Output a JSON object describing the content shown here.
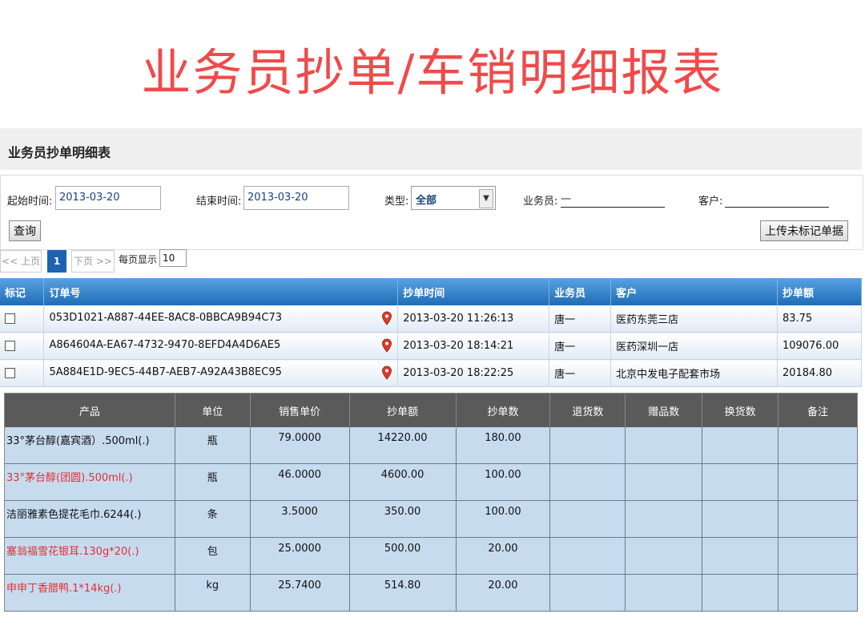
{
  "banner": "业务员抄单/车销明细报表",
  "panel_title": "业务员抄单明细表",
  "filters": {
    "start_label": "起始时间:",
    "start_value": "2013-03-20",
    "end_label": "结束时间:",
    "end_value": "2013-03-20",
    "type_label": "类型:",
    "type_value": "全部",
    "salesman_label": "业务员:",
    "salesman_value": "一",
    "customer_label": "客户:",
    "customer_value": "",
    "query_button": "查询",
    "upload_button": "上传未标记单据"
  },
  "pager": {
    "prev": "<< 上页",
    "page": "1",
    "next": "下页 >>",
    "per_page_label": "每页显示",
    "per_page_value": "10"
  },
  "orders": {
    "headers": [
      "标记",
      "订单号",
      "抄单时间",
      "业务员",
      "客户",
      "抄单额"
    ],
    "rows": [
      {
        "id": "053D1021-A887-44EE-8AC8-0BBCA9B94C73",
        "time": "2013-03-20 11:26:13",
        "salesman": "唐一",
        "customer": "医药东莞三店",
        "amount": "83.75"
      },
      {
        "id": "A864604A-EA67-4732-9470-8EFD4A4D6AE5",
        "time": "2013-03-20 18:14:21",
        "salesman": "唐一",
        "customer": "医药深圳一店",
        "amount": "109076.00"
      },
      {
        "id": "5A884E1D-9EC5-44B7-AEB7-A92A43B8EC95",
        "time": "2013-03-20 18:22:25",
        "salesman": "唐一",
        "customer": "北京中发电子配套市场",
        "amount": "20184.80"
      }
    ]
  },
  "details": {
    "headers": [
      "产品",
      "单位",
      "销售单价",
      "抄单额",
      "抄单数",
      "退货数",
      "赠品数",
      "换货数",
      "备注"
    ],
    "rows": [
      {
        "product": "33°茅台醇(嘉宾酒）.500ml(.)",
        "unit": "瓶",
        "price": "79.0000",
        "amount": "14220.00",
        "qty": "180.00",
        "red": false
      },
      {
        "product": "33°茅台醇(团圆).500ml(.)",
        "unit": "瓶",
        "price": "46.0000",
        "amount": "4600.00",
        "qty": "100.00",
        "red": true
      },
      {
        "product": "洁丽雅素色提花毛巾.6244(.)",
        "unit": "条",
        "price": "3.5000",
        "amount": "350.00",
        "qty": "100.00",
        "red": false
      },
      {
        "product": "塞翁福雪花银耳.130g*20(.)",
        "unit": "包",
        "price": "25.0000",
        "amount": "500.00",
        "qty": "20.00",
        "red": true
      },
      {
        "product": "申申丁香腊鸭.1*14kg(.)",
        "unit": "kg",
        "price": "25.7400",
        "amount": "514.80",
        "qty": "20.00",
        "red": true
      }
    ]
  }
}
